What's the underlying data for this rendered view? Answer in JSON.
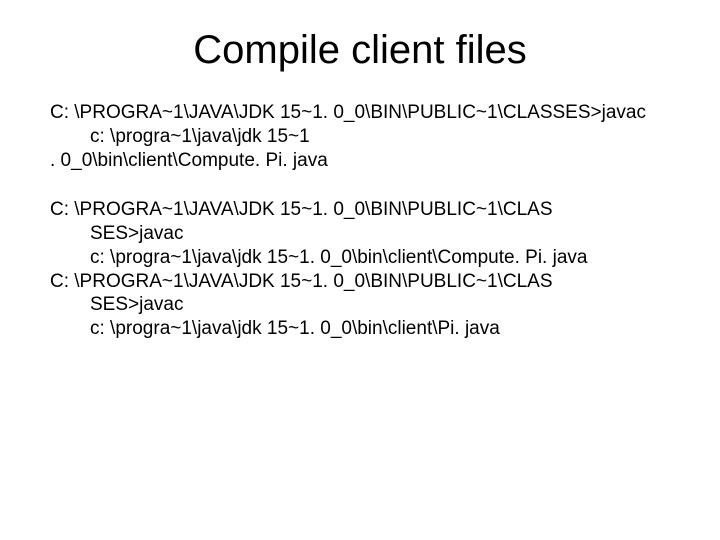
{
  "title": "Compile client files",
  "block1": {
    "line1": "C: \\PROGRA~1\\JAVA\\JDK 15~1. 0_0\\BIN\\PUBLIC~1\\CLASSES>javac",
    "line2": "c: \\progra~1\\java\\jdk 15~1",
    "line3": ". 0_0\\bin\\client\\Compute. Pi. java"
  },
  "block2": {
    "line1": "C: \\PROGRA~1\\JAVA\\JDK 15~1. 0_0\\BIN\\PUBLIC~1\\CLAS",
    "line2": "SES>javac",
    "line3": "c: \\progra~1\\java\\jdk 15~1. 0_0\\bin\\client\\Compute. Pi. java",
    "line4": "C: \\PROGRA~1\\JAVA\\JDK 15~1. 0_0\\BIN\\PUBLIC~1\\CLAS",
    "line5": "SES>javac",
    "line6": "c: \\progra~1\\java\\jdk 15~1. 0_0\\bin\\client\\Pi. java"
  }
}
